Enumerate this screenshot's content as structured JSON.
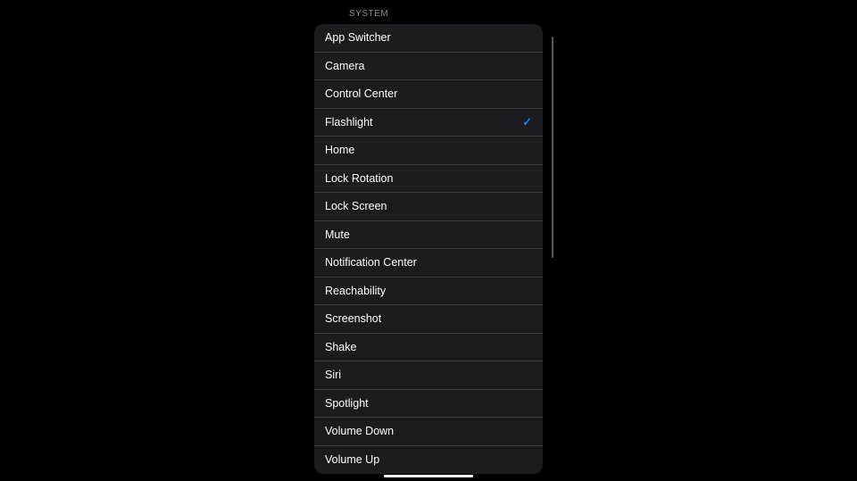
{
  "section_header": "SYSTEM",
  "selected": "Flashlight",
  "items": [
    {
      "label": "App Switcher"
    },
    {
      "label": "Camera"
    },
    {
      "label": "Control Center"
    },
    {
      "label": "Flashlight"
    },
    {
      "label": "Home"
    },
    {
      "label": "Lock Rotation"
    },
    {
      "label": "Lock Screen"
    },
    {
      "label": "Mute"
    },
    {
      "label": "Notification Center"
    },
    {
      "label": "Reachability"
    },
    {
      "label": "Screenshot"
    },
    {
      "label": "Shake"
    },
    {
      "label": "Siri"
    },
    {
      "label": "Spotlight"
    },
    {
      "label": "Volume Down"
    },
    {
      "label": "Volume Up"
    }
  ],
  "checkmark_glyph": "✓"
}
